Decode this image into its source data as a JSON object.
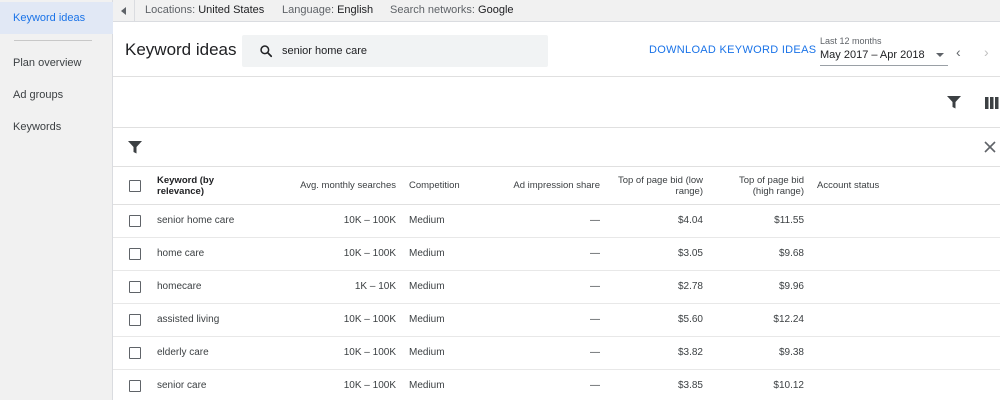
{
  "sidebar": {
    "items": [
      {
        "label": "Keyword ideas",
        "active": true
      },
      {
        "label": "Plan overview"
      },
      {
        "label": "Ad groups"
      },
      {
        "label": "Keywords"
      }
    ]
  },
  "infobar": {
    "locations_label": "Locations:",
    "locations_value": "United States",
    "language_label": "Language:",
    "language_value": "English",
    "networks_label": "Search networks:",
    "networks_value": "Google"
  },
  "header": {
    "title": "Keyword ideas",
    "search_value": "senior home care",
    "download_label": "DOWNLOAD KEYWORD IDEAS",
    "date_caption": "Last 12 months",
    "date_range": "May 2017 – Apr 2018"
  },
  "table": {
    "headers": {
      "keyword_line1": "Keyword (by",
      "keyword_line2": "relevance)",
      "avg": "Avg. monthly searches",
      "competition": "Competition",
      "impression": "Ad impression share",
      "low_line1": "Top of page bid (low",
      "low_line2": "range)",
      "high_line1": "Top of page bid",
      "high_line2": "(high range)",
      "account": "Account status"
    },
    "rows": [
      {
        "keyword": "senior home care",
        "avg": "10K – 100K",
        "competition": "Medium",
        "impression": "—",
        "low": "$4.04",
        "high": "$11.55"
      },
      {
        "keyword": "home care",
        "avg": "10K – 100K",
        "competition": "Medium",
        "impression": "—",
        "low": "$3.05",
        "high": "$9.68"
      },
      {
        "keyword": "homecare",
        "avg": "1K – 10K",
        "competition": "Medium",
        "impression": "—",
        "low": "$2.78",
        "high": "$9.96"
      },
      {
        "keyword": "assisted living",
        "avg": "10K – 100K",
        "competition": "Medium",
        "impression": "—",
        "low": "$5.60",
        "high": "$12.24"
      },
      {
        "keyword": "elderly care",
        "avg": "10K – 100K",
        "competition": "Medium",
        "impression": "—",
        "low": "$3.82",
        "high": "$9.38"
      },
      {
        "keyword": "senior care",
        "avg": "10K – 100K",
        "competition": "Medium",
        "impression": "—",
        "low": "$3.85",
        "high": "$10.12"
      }
    ]
  },
  "colors": {
    "accent": "#1a73e8",
    "sidebar_bg": "#f1f1f1",
    "active_bg": "#e1e8f5"
  }
}
